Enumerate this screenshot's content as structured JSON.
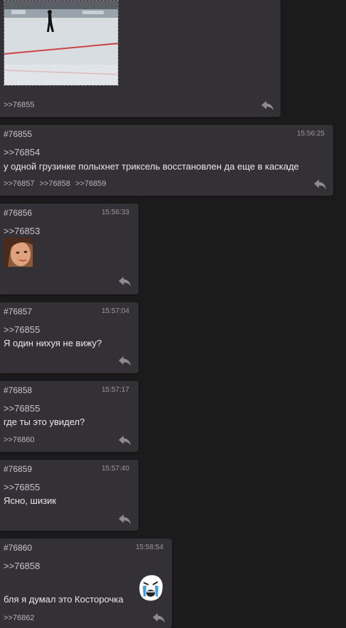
{
  "posts": [
    {
      "id": "",
      "time": "",
      "quote": "",
      "text": "",
      "replies": [
        "&gt;&gt;76855"
      ]
    },
    {
      "id": "#76855",
      "time": "15:56:25",
      "quote": ">>76854",
      "text": "у одной грузинке полыхнет триксель восстановлен да еще в каскаде",
      "replies": [
        ">>76857",
        ">>76858",
        ">>76859"
      ]
    },
    {
      "id": "#76856",
      "time": "15:56:33",
      "quote": ">>76853",
      "text": "",
      "replies": []
    },
    {
      "id": "#76857",
      "time": "15:57:04",
      "quote": ">>76855",
      "text": "Я один нихуя не вижу?",
      "replies": []
    },
    {
      "id": "#76858",
      "time": "15:57:17",
      "quote": ">>76855",
      "text": "где ты это увидел?",
      "replies": [
        ">>76860"
      ]
    },
    {
      "id": "#76859",
      "time": "15:57:40",
      "quote": ">>76855",
      "text": "Ясно, шизик",
      "replies": []
    },
    {
      "id": "#76860",
      "time": "15:58:54",
      "quote": ">>76858",
      "text": "бля я думал это Косторочка",
      "replies": [
        ">>76862"
      ]
    }
  ],
  "top_post_reply": ">>76855",
  "icons": {
    "reply": "reply-arrow-icon",
    "thumb1": "ice-rink-thumbnail",
    "thumb2": "face-thumbnail",
    "thumb3": "crying-meme-face"
  },
  "colors": {
    "background": "#1b1b1c",
    "post": "#333136"
  }
}
